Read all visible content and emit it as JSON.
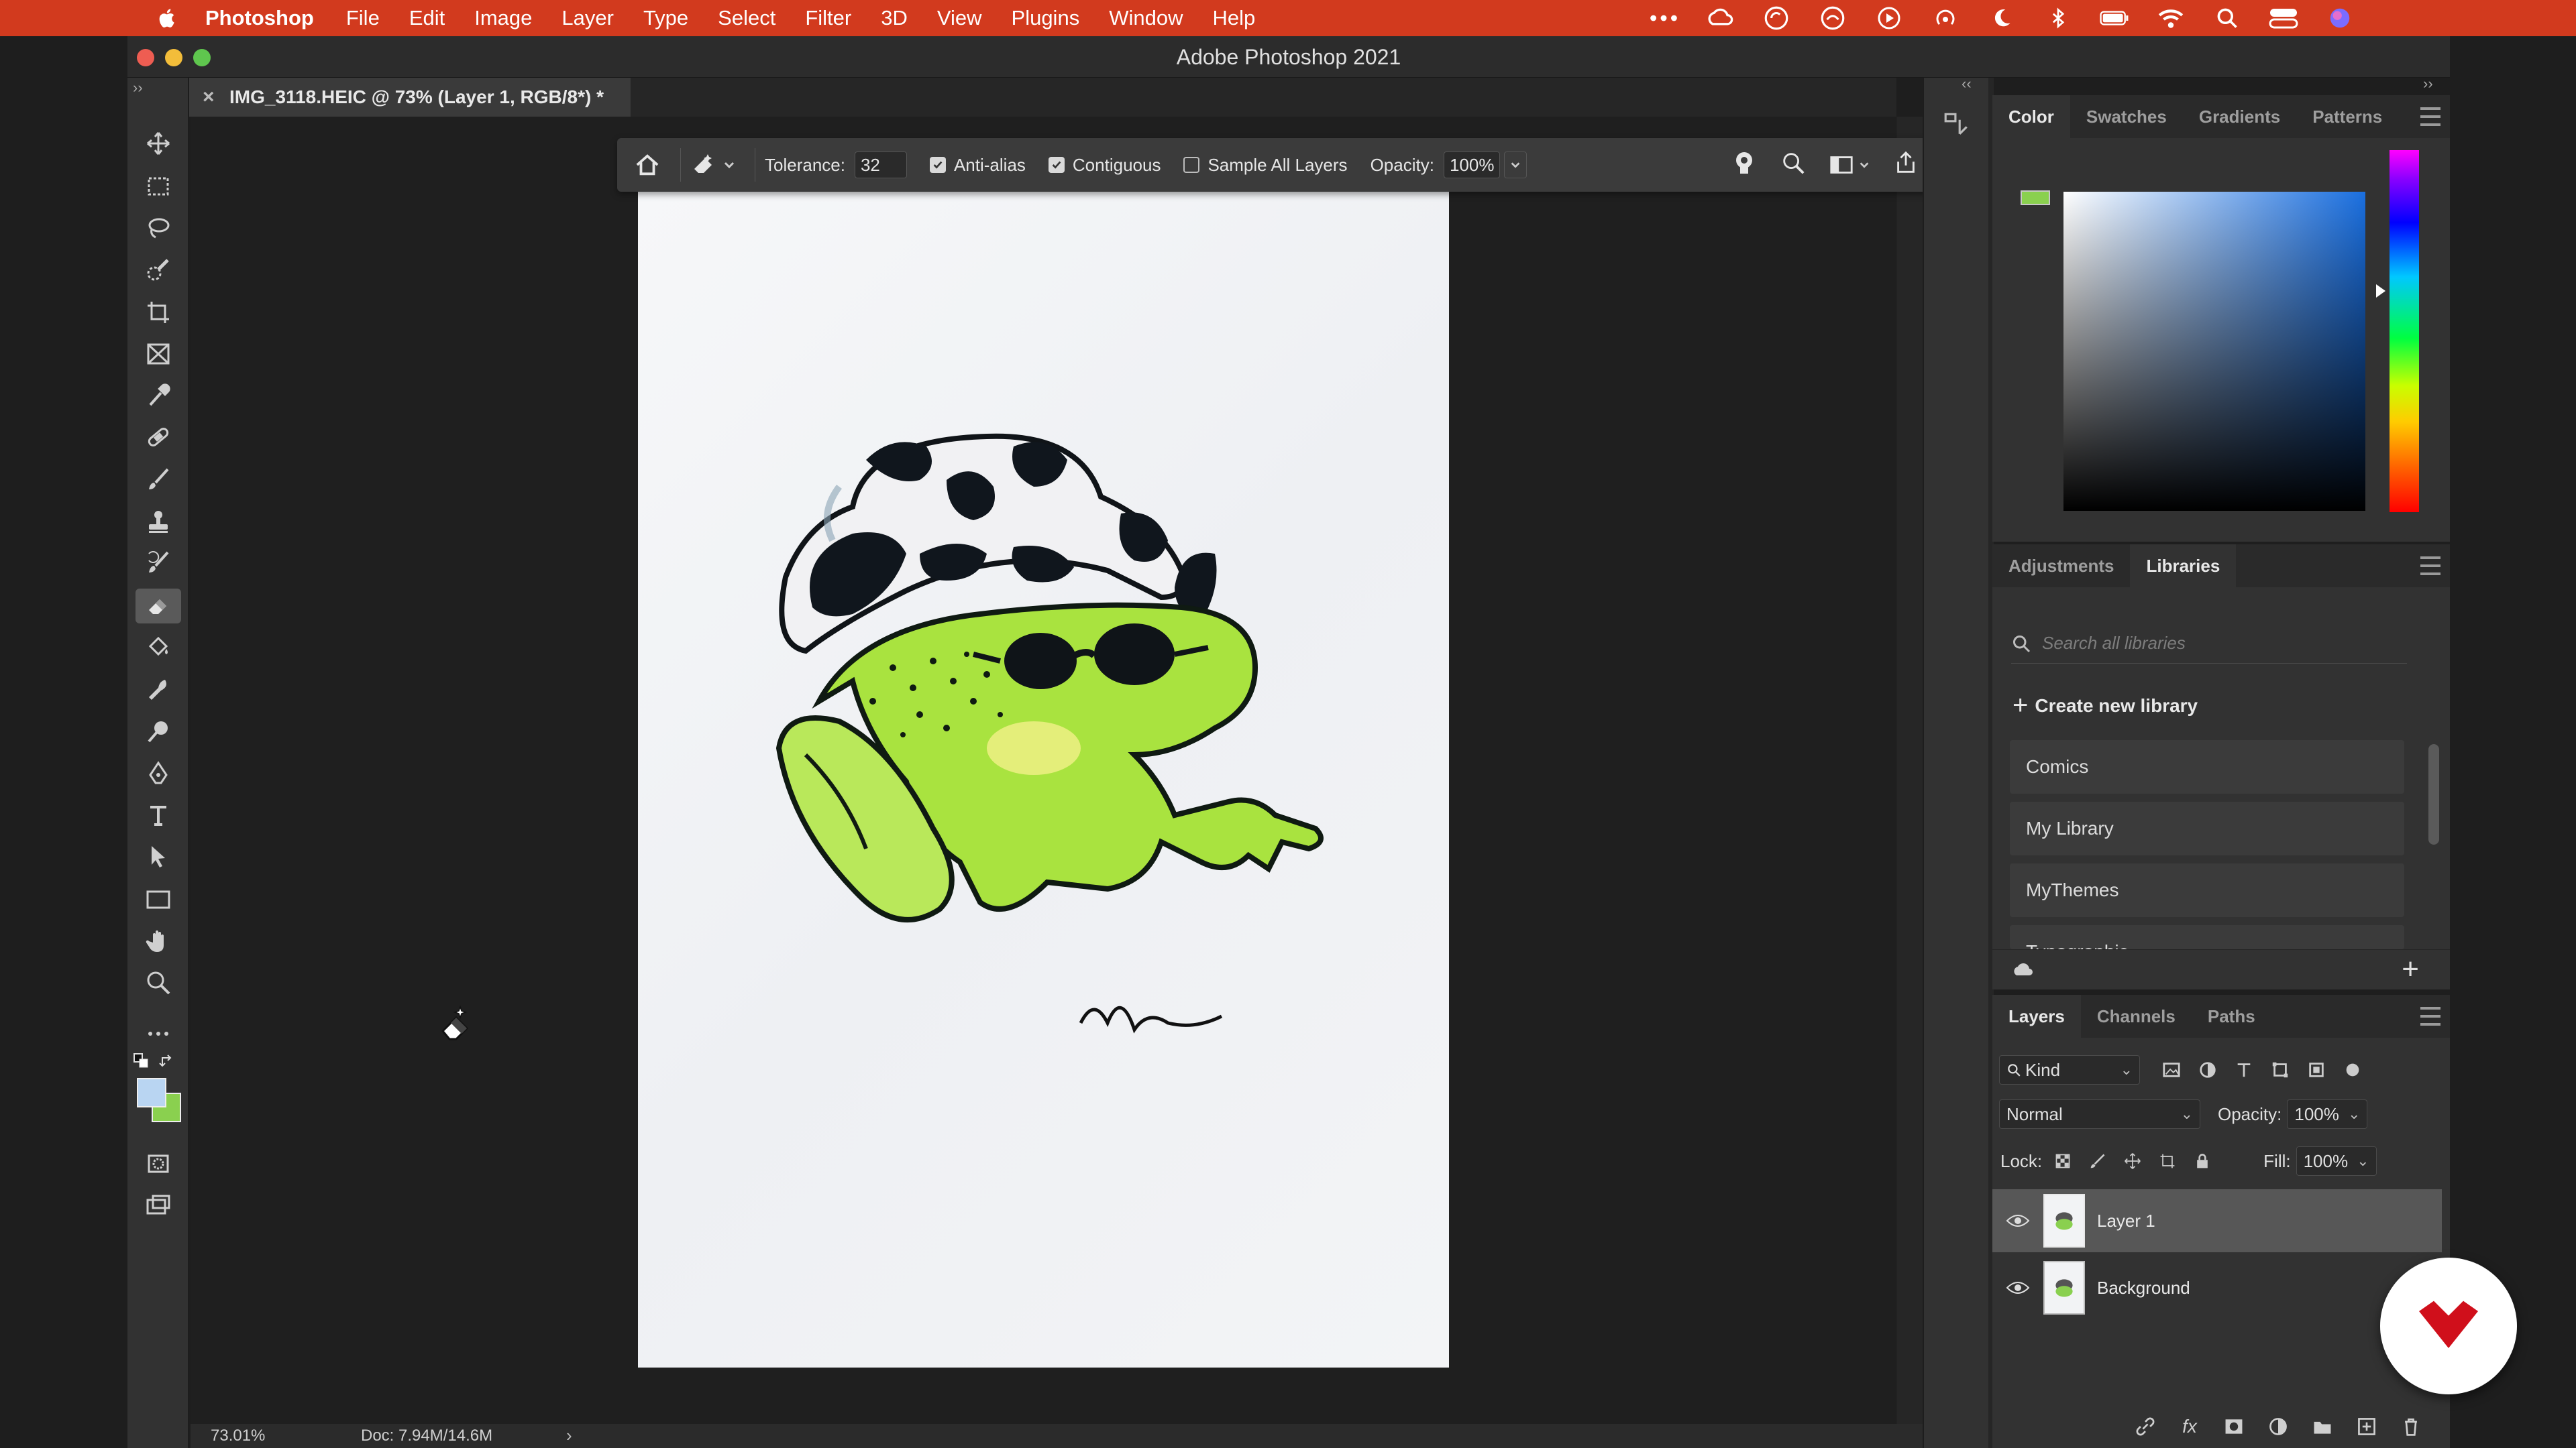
{
  "menubar": {
    "app_name": "Photoshop",
    "items": [
      "File",
      "Edit",
      "Image",
      "Layer",
      "Type",
      "Select",
      "Filter",
      "3D",
      "View",
      "Plugins",
      "Window",
      "Help"
    ]
  },
  "window": {
    "title": "Adobe Photoshop 2021"
  },
  "document": {
    "tab_title": "IMG_3118.HEIC @ 73% (Layer 1, RGB/8*) *"
  },
  "options": {
    "tolerance_label": "Tolerance:",
    "tolerance_value": "32",
    "antialias_label": "Anti-alias",
    "antialias_checked": true,
    "contiguous_label": "Contiguous",
    "contiguous_checked": true,
    "sample_all_label": "Sample All Layers",
    "sample_all_checked": false,
    "opacity_label": "Opacity:",
    "opacity_value": "100%"
  },
  "color_panel": {
    "tabs": [
      "Color",
      "Swatches",
      "Gradients",
      "Patterns"
    ],
    "active_tab": "Color",
    "foreground_color": "#8ad04f"
  },
  "libraries_panel": {
    "tabs": [
      "Adjustments",
      "Libraries"
    ],
    "active_tab": "Libraries",
    "search_placeholder": "Search all libraries",
    "create_label": "Create new library",
    "items": [
      "Comics",
      "My Library",
      "MyThemes",
      "Typographic"
    ]
  },
  "layers_panel": {
    "tabs": [
      "Layers",
      "Channels",
      "Paths"
    ],
    "active_tab": "Layers",
    "filter_kind": "Kind",
    "blend_mode": "Normal",
    "opacity_label": "Opacity:",
    "opacity_value": "100%",
    "lock_label": "Lock:",
    "fill_label": "Fill:",
    "fill_value": "100%",
    "layers": [
      {
        "name": "Layer 1",
        "selected": true,
        "locked": false
      },
      {
        "name": "Background",
        "selected": false,
        "locked": true
      }
    ]
  },
  "statusbar": {
    "zoom": "73.01%",
    "doc_info": "Doc: 7.94M/14.6M"
  },
  "colors": {
    "menubar_bg": "#d23a1e",
    "panel_bg": "#323232",
    "canvas_bg": "#1f1f1f",
    "frog_green": "#8ad04f"
  },
  "icons": {
    "tools": [
      "move-icon",
      "marquee-icon",
      "lasso-icon",
      "quick-select-icon",
      "crop-icon",
      "frame-icon",
      "eyedropper-icon",
      "healing-icon",
      "brush-icon",
      "stamp-icon",
      "history-brush-icon",
      "eraser-icon",
      "paint-bucket-icon",
      "smudge-icon",
      "dodge-icon",
      "pen-icon",
      "type-icon",
      "path-select-icon",
      "rectangle-icon",
      "hand-icon",
      "zoom-icon",
      "more-tools-icon"
    ]
  }
}
